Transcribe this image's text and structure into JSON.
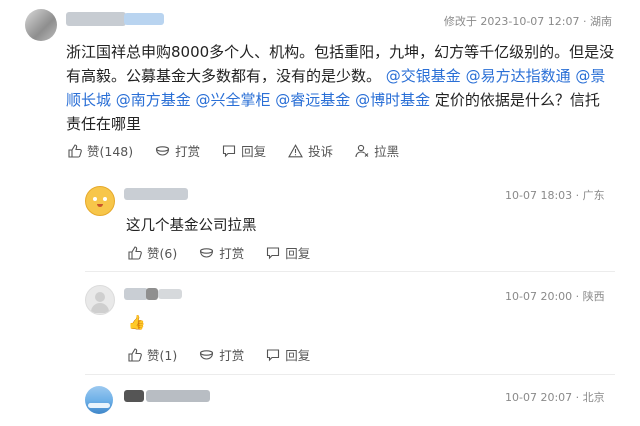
{
  "main_comment": {
    "meta": "修改于 2023-10-07 12:07 · 湖南",
    "text_plain": "浙江国祥总申购8000多个人、机构。包括重阳，九坤，幻方等千亿级别的。但是没有高毅。公募基金大多数都有，没有的是少数。",
    "mentions": [
      "@交银基金",
      "@易方达指数通",
      "@景顺长城",
      "@南方基金",
      "@兴全掌柜",
      "@睿远基金",
      "@博时基金"
    ],
    "text_tail": "定价的依据是什么？信托责任在哪里",
    "line1": "浙江国祥总申购8000多个人、机构。包括重阳，九坤，幻方等千亿级别的。但是没",
    "line2_a": "有高毅。公募基金大多数都有，没有的是少数。",
    "line2_b": "@交银基金 @易方达指数通 @景",
    "line3_a": "顺长城 @南方基金 @兴全掌柜 @睿远基金 @博时基金",
    "line3_b": " 定价的依据是什么？信托",
    "line4": "责任在哪里",
    "actions": {
      "like": "赞(148)",
      "reward": "打赏",
      "reply": "回复",
      "report": "投诉",
      "block": "拉黑"
    }
  },
  "replies": [
    {
      "meta_date": "10-07 18:03",
      "meta_loc": "广东",
      "text": "这几个基金公司拉黑",
      "actions": {
        "like": "赞(6)",
        "reward": "打赏",
        "reply": "回复"
      }
    },
    {
      "meta_date": "10-07 20:00",
      "meta_loc": "陕西",
      "text": "👍",
      "actions": {
        "like": "赞(1)",
        "reward": "打赏",
        "reply": "回复"
      }
    },
    {
      "meta_date": "10-07 20:07",
      "meta_loc": "北京"
    }
  ],
  "colors": {
    "mention": "#2a6fd6",
    "text": "#222222",
    "meta": "#8a8a8a"
  }
}
